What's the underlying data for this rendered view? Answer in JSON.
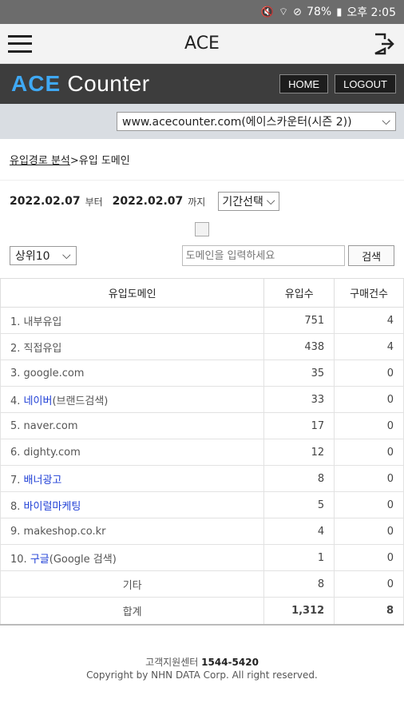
{
  "status_bar": {
    "battery": "78%",
    "time": "오후 2:05"
  },
  "app_bar": {
    "title": "ACE"
  },
  "brand": {
    "logo_ace": "ACE",
    "logo_counter": "Counter",
    "home_label": "HOME",
    "logout_label": "LOGOUT"
  },
  "site_select": {
    "value": "www.acecounter.com(에이스카운터(시즌 2))"
  },
  "breadcrumb": {
    "link": "유입경로 분석",
    "current": ">유입 도메인"
  },
  "date_range": {
    "start": "2022.02.07",
    "start_suffix": "부터",
    "end": "2022.02.07",
    "end_suffix": "까지",
    "period_select": "기간선택"
  },
  "filter": {
    "top_select": "상위10",
    "search_placeholder": "도메인을 입력하세요",
    "search_button": "검색"
  },
  "table": {
    "headers": [
      "유입도메인",
      "유입수",
      "구매건수"
    ],
    "rows": [
      {
        "rank": "1.",
        "name": "내부유입",
        "visits": "751",
        "purchases": "4"
      },
      {
        "rank": "2.",
        "name": "직접유입",
        "visits": "438",
        "purchases": "4"
      },
      {
        "rank": "3.",
        "name": "google.com",
        "visits": "35",
        "purchases": "0"
      },
      {
        "rank": "4.",
        "name_link": "네이버",
        "name_rest": "(브랜드검색)",
        "visits": "33",
        "purchases": "0"
      },
      {
        "rank": "5.",
        "name": "naver.com",
        "visits": "17",
        "purchases": "0"
      },
      {
        "rank": "6.",
        "name": "dighty.com",
        "visits": "12",
        "purchases": "0"
      },
      {
        "rank": "7.",
        "name_link": "배너광고",
        "visits": "8",
        "purchases": "0"
      },
      {
        "rank": "8.",
        "name_link": "바이럴마케팅",
        "visits": "5",
        "purchases": "0"
      },
      {
        "rank": "9.",
        "name": "makeshop.co.kr",
        "visits": "4",
        "purchases": "0"
      },
      {
        "rank": "10.",
        "name_link": "구글",
        "name_rest": "(Google 검색)",
        "visits": "1",
        "purchases": "0"
      }
    ],
    "other": {
      "name": "기타",
      "visits": "8",
      "purchases": "0"
    },
    "total": {
      "name": "합계",
      "visits": "1,312",
      "purchases": "8"
    }
  },
  "footer": {
    "support_label": "고객지원센터",
    "support_phone": "1544-5420",
    "copyright": "Copyright by NHN DATA Corp. All right reserved."
  },
  "colors": {
    "brand_bar": "#3d3d3d",
    "logo_accent": "#3fa9f5",
    "link_blue": "#1f3fd6",
    "site_bar": "#d9dde2"
  }
}
